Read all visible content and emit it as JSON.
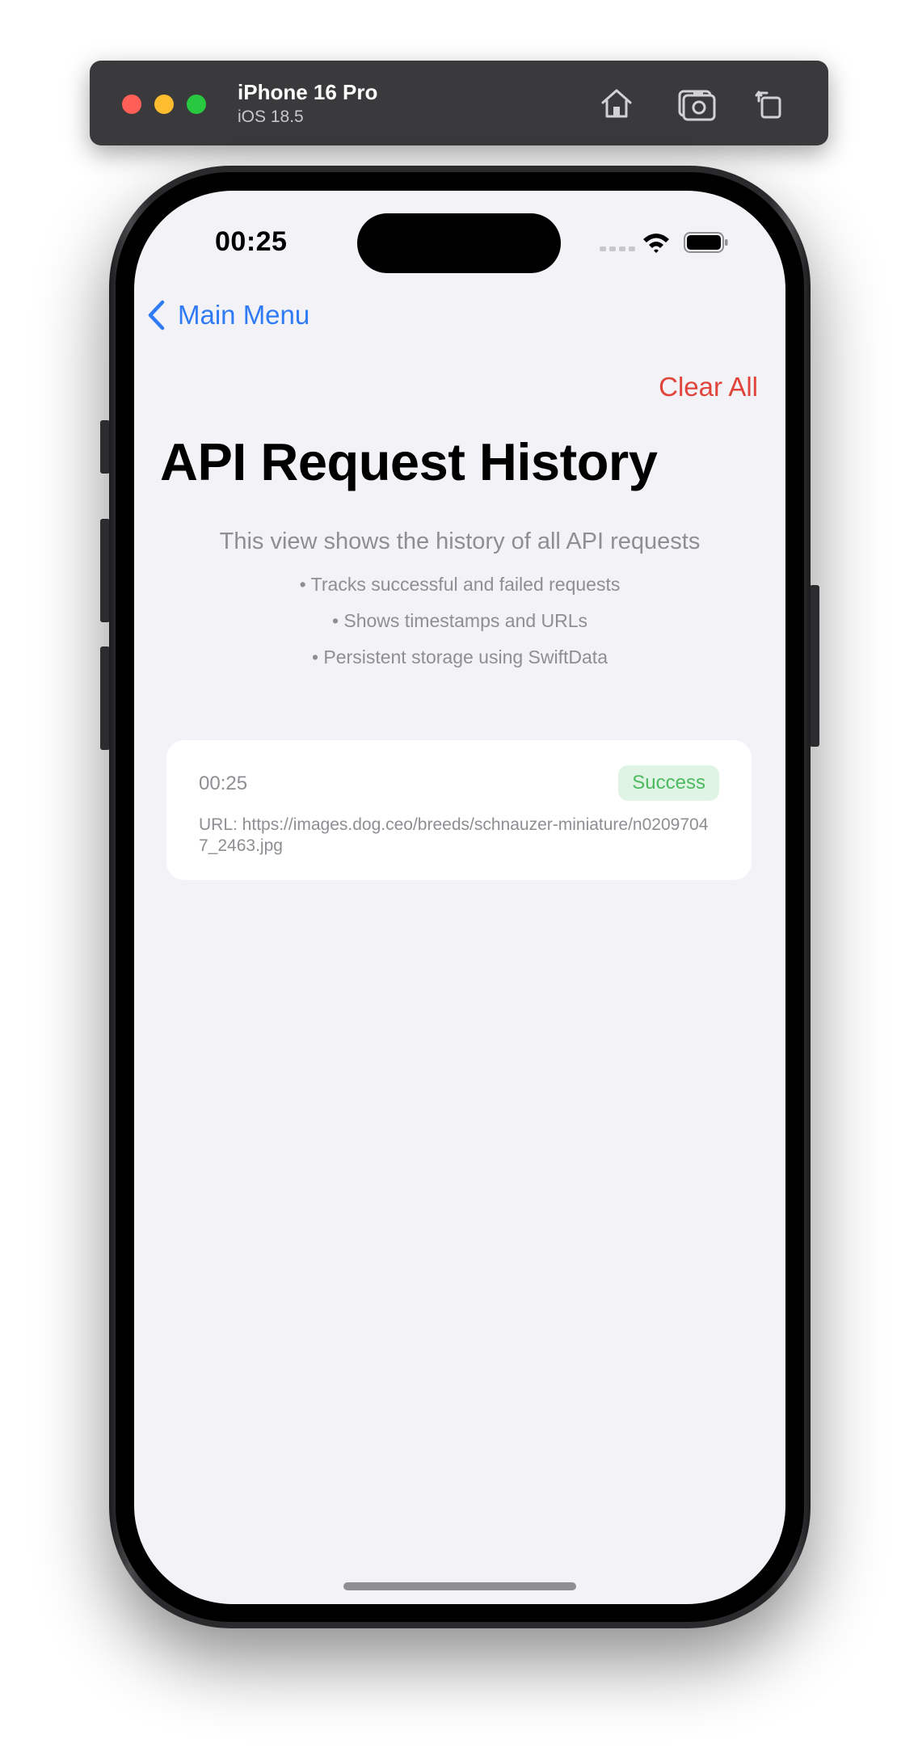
{
  "simulator": {
    "device_name": "iPhone 16 Pro",
    "os_version": "iOS 18.5"
  },
  "status_bar": {
    "time": "00:25"
  },
  "nav": {
    "back_label": "Main Menu",
    "clear_all_label": "Clear All"
  },
  "page": {
    "title": "API Request History",
    "info_heading": "This view shows the history of all API requests",
    "info_points": [
      "• Tracks successful and failed requests",
      "• Shows timestamps and URLs",
      "• Persistent storage using SwiftData"
    ]
  },
  "history": [
    {
      "time": "00:25",
      "status": "Success",
      "url": "URL: https://images.dog.ceo/breeds/schnauzer-miniature/n02097047_2463.jpg"
    }
  ],
  "colors": {
    "accent": "#2f7bf6",
    "destructive": "#e0443b",
    "success_text": "#4cbb5f",
    "success_bg": "#dff4e4",
    "background": "#f2f2f7"
  }
}
